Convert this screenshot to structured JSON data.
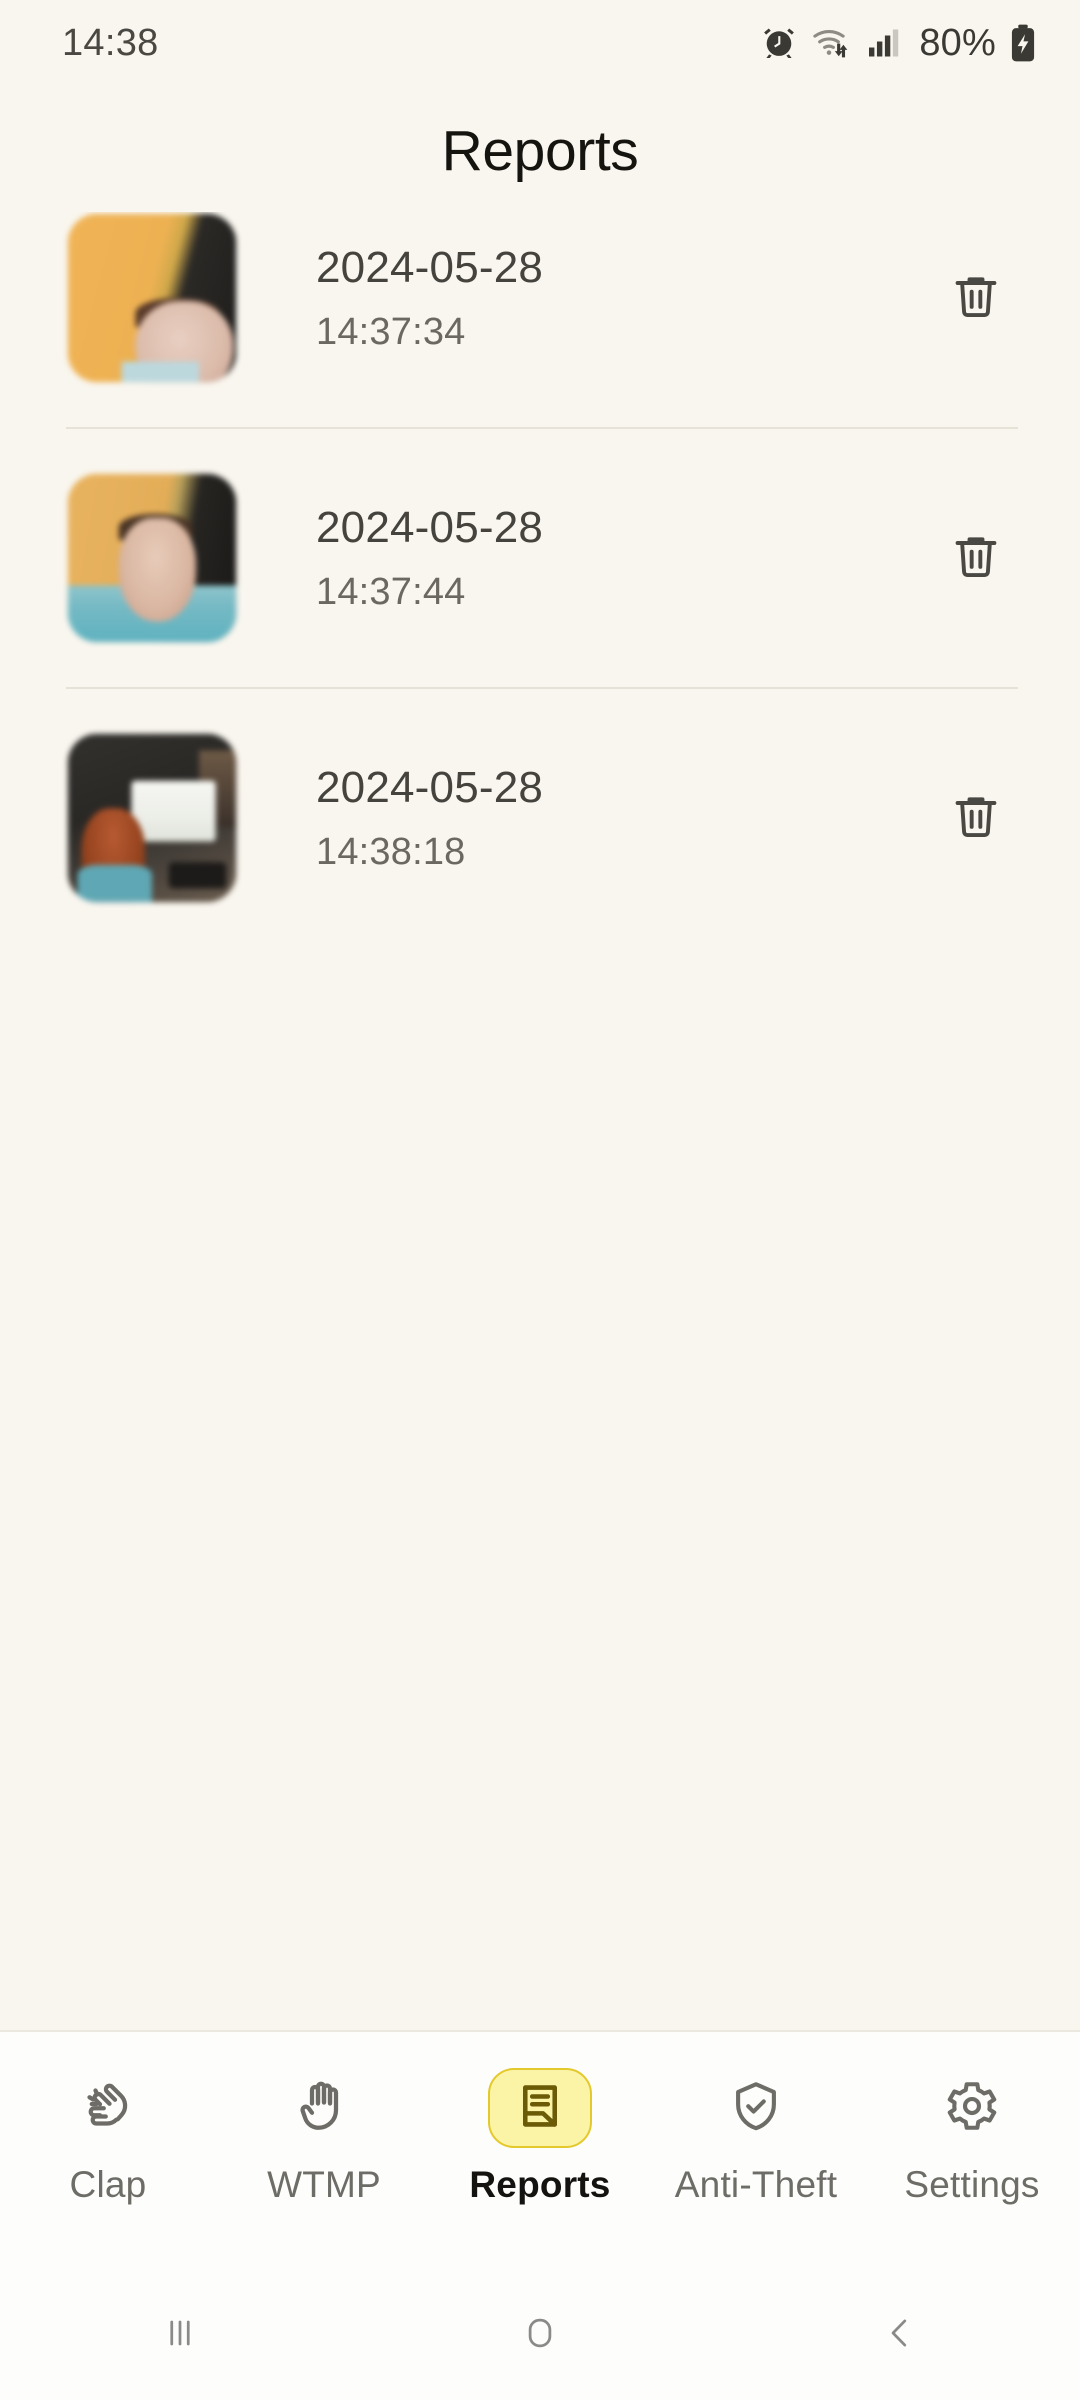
{
  "status_bar": {
    "clock": "14:38",
    "battery_percent": "80%",
    "icons": [
      "alarm-icon",
      "wifi-icon",
      "cellular-signal-icon",
      "battery-charging-icon"
    ]
  },
  "header": {
    "title": "Reports"
  },
  "reports": [
    {
      "date": "2024-05-28",
      "time": "14:37:34",
      "thumbnail": "blurred-selfie-1",
      "delete_icon": "trash-icon"
    },
    {
      "date": "2024-05-28",
      "time": "14:37:44",
      "thumbnail": "blurred-selfie-2",
      "delete_icon": "trash-icon"
    },
    {
      "date": "2024-05-28",
      "time": "14:38:18",
      "thumbnail": "blurred-desk-photo-3",
      "delete_icon": "trash-icon"
    }
  ],
  "bottom_nav": {
    "active_index": 2,
    "items": [
      {
        "label": "Clap",
        "icon": "clapping-hands-icon"
      },
      {
        "label": "WTMP",
        "icon": "raised-hand-icon"
      },
      {
        "label": "Reports",
        "icon": "document-report-icon"
      },
      {
        "label": "Anti-Theft",
        "icon": "shield-check-icon"
      },
      {
        "label": "Settings",
        "icon": "gear-icon"
      }
    ]
  },
  "system_nav": {
    "recents": "recents-icon",
    "home": "home-icon",
    "back": "back-icon"
  },
  "colors": {
    "background": "#F9F6EF",
    "nav_background": "#FDFDFC",
    "accent_pill": "#FBF3A6",
    "accent_border": "#E3C92B",
    "accent_icon": "#6B5A06",
    "text_primary": "#15140F",
    "text_secondary": "#6A6861",
    "divider": "#E6E2D8"
  }
}
